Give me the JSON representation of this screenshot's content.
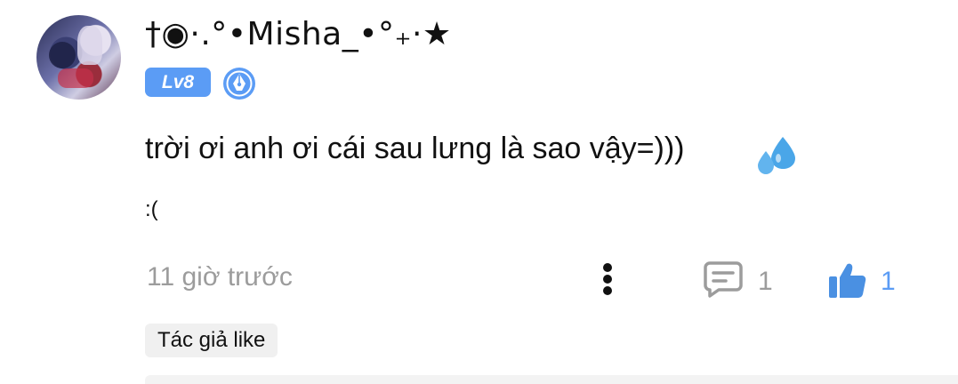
{
  "comment": {
    "username": "†◉·.°•Misha_•°₊·★",
    "level": "Lv8",
    "text": "trời ơi anh ơi cái sau lưng là sao vậy=)))",
    "emote": ":(",
    "timestamp": "11 giờ trước",
    "reply_count": "1",
    "like_count": "1",
    "author_like_label": "Tác giả like"
  },
  "icons": {
    "badge": "pen-nib-icon",
    "emoji": "sweat-droplets-icon",
    "more": "more-vertical-icon",
    "reply": "comment-icon",
    "like": "thumbs-up-icon"
  },
  "colors": {
    "accent": "#5b9cf5",
    "muted_text": "#9c9c9c",
    "text": "#111111",
    "tag_bg": "#f0f0f0"
  }
}
